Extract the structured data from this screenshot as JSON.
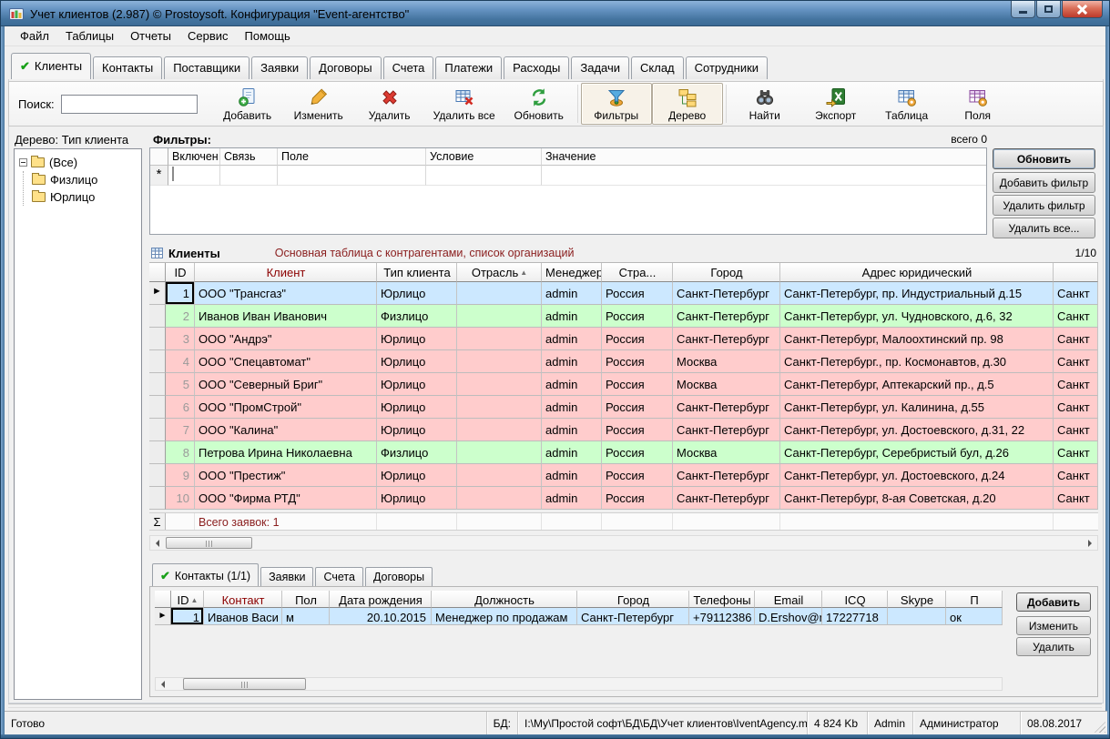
{
  "window": {
    "title": "Учет клиентов (2.987) © Prostoysoft. Конфигурация \"Event-агентство\""
  },
  "menu": {
    "items": [
      "Файл",
      "Таблицы",
      "Отчеты",
      "Сервис",
      "Помощь"
    ]
  },
  "tabs": {
    "items": [
      {
        "label": "Клиенты",
        "active": true
      },
      {
        "label": "Контакты",
        "active": false
      },
      {
        "label": "Поставщики",
        "active": false
      },
      {
        "label": "Заявки",
        "active": false
      },
      {
        "label": "Договоры",
        "active": false
      },
      {
        "label": "Счета",
        "active": false
      },
      {
        "label": "Платежи",
        "active": false
      },
      {
        "label": "Расходы",
        "active": false
      },
      {
        "label": "Задачи",
        "active": false
      },
      {
        "label": "Склад",
        "active": false
      },
      {
        "label": "Сотрудники",
        "active": false
      }
    ]
  },
  "toolbar": {
    "search_label": "Поиск:",
    "search_value": "",
    "buttons": [
      {
        "name": "add",
        "label": "Добавить",
        "toggled": false
      },
      {
        "name": "edit",
        "label": "Изменить",
        "toggled": false
      },
      {
        "name": "delete",
        "label": "Удалить",
        "toggled": false
      },
      {
        "name": "delete-all",
        "label": "Удалить все",
        "toggled": false
      },
      {
        "name": "refresh",
        "label": "Обновить",
        "toggled": false
      },
      {
        "name": "filters",
        "label": "Фильтры",
        "toggled": true
      },
      {
        "name": "tree",
        "label": "Дерево",
        "toggled": true
      },
      {
        "name": "find",
        "label": "Найти",
        "toggled": false
      },
      {
        "name": "export",
        "label": "Экспорт",
        "toggled": false
      },
      {
        "name": "table",
        "label": "Таблица",
        "toggled": false
      },
      {
        "name": "fields",
        "label": "Поля",
        "toggled": false
      }
    ]
  },
  "tree": {
    "title": "Дерево: Тип клиента",
    "root": "(Все)",
    "children": [
      "Физлицо",
      "Юрлицо"
    ]
  },
  "filters": {
    "title": "Фильтры:",
    "count_label": "всего 0",
    "columns": [
      "Включен",
      "Связь",
      "Поле",
      "Условие",
      "Значение"
    ],
    "buttons": [
      {
        "label": "Обновить",
        "default": true
      },
      {
        "label": "Добавить фильтр",
        "default": false
      },
      {
        "label": "Удалить фильтр",
        "default": false
      },
      {
        "label": "Удалить все...",
        "default": false
      }
    ]
  },
  "clients": {
    "title": "Клиенты",
    "subtitle": "Основная таблица с контрагентами, список организаций",
    "pager": "1/10",
    "columns": [
      {
        "label": "ID",
        "accent": false,
        "sorted": false
      },
      {
        "label": "Клиент",
        "accent": true,
        "sorted": false
      },
      {
        "label": "Тип клиента",
        "accent": false,
        "sorted": false
      },
      {
        "label": "Отрасль",
        "accent": false,
        "sorted": true
      },
      {
        "label": "Менеджер",
        "accent": false,
        "sorted": false
      },
      {
        "label": "Стра...",
        "accent": false,
        "sorted": false
      },
      {
        "label": "Город",
        "accent": false,
        "sorted": false
      },
      {
        "label": "Адрес юридический",
        "accent": false,
        "sorted": false
      },
      {
        "label": "",
        "accent": false,
        "sorted": false
      }
    ],
    "rows": [
      {
        "id": "1",
        "client": "ООО \"Трансгаз\"",
        "type": "Юрлицо",
        "industry": "",
        "manager": "admin",
        "country": "Россия",
        "city": "Санкт-Петербург",
        "address": "Санкт-Петербург, пр. Индустриальный д.15",
        "address2": "Санкт",
        "state": "selected"
      },
      {
        "id": "2",
        "client": "Иванов Иван Иванович",
        "type": "Физлицо",
        "industry": "",
        "manager": "admin",
        "country": "Россия",
        "city": "Санкт-Петербург",
        "address": "Санкт-Петербург, ул. Чудновского, д.6, 32",
        "address2": "Санкт",
        "state": "person"
      },
      {
        "id": "3",
        "client": "ООО \"Андрэ\"",
        "type": "Юрлицо",
        "industry": "",
        "manager": "admin",
        "country": "Россия",
        "city": "Санкт-Петербург",
        "address": "Санкт-Петербург, Малоохтинский пр. 98",
        "address2": "Санкт",
        "state": "org"
      },
      {
        "id": "4",
        "client": "ООО \"Спецавтомат\"",
        "type": "Юрлицо",
        "industry": "",
        "manager": "admin",
        "country": "Россия",
        "city": "Москва",
        "address": "Санкт-Петербург., пр. Космонавтов, д.30",
        "address2": "Санкт",
        "state": "org"
      },
      {
        "id": "5",
        "client": "ООО \"Северный Бриг\"",
        "type": "Юрлицо",
        "industry": "",
        "manager": "admin",
        "country": "Россия",
        "city": "Москва",
        "address": "Санкт-Петербург, Аптекарский пр., д.5",
        "address2": "Санкт",
        "state": "org"
      },
      {
        "id": "6",
        "client": "ООО \"ПромСтрой\"",
        "type": "Юрлицо",
        "industry": "",
        "manager": "admin",
        "country": "Россия",
        "city": "Санкт-Петербург",
        "address": "Санкт-Петербург, ул. Калинина, д.55",
        "address2": "Санкт",
        "state": "org"
      },
      {
        "id": "7",
        "client": "ООО \"Калина\"",
        "type": "Юрлицо",
        "industry": "",
        "manager": "admin",
        "country": "Россия",
        "city": "Санкт-Петербург",
        "address": "Санкт-Петербург, ул. Достоевского, д.31, 22",
        "address2": "Санкт",
        "state": "org"
      },
      {
        "id": "8",
        "client": "Петрова Ирина Николаевна",
        "type": "Физлицо",
        "industry": "",
        "manager": "admin",
        "country": "Россия",
        "city": "Москва",
        "address": "Санкт-Петербург, Серебристый бул, д.26",
        "address2": "Санкт",
        "state": "person"
      },
      {
        "id": "9",
        "client": "ООО \"Престиж\"",
        "type": "Юрлицо",
        "industry": "",
        "manager": "admin",
        "country": "Россия",
        "city": "Санкт-Петербург",
        "address": "Санкт-Петербург, ул. Достоевского, д.24",
        "address2": "Санкт",
        "state": "org"
      },
      {
        "id": "10",
        "client": "ООО \"Фирма РТД\"",
        "type": "Юрлицо",
        "industry": "",
        "manager": "admin",
        "country": "Россия",
        "city": "Санкт-Петербург",
        "address": "Санкт-Петербург, 8-ая Советская, д.20",
        "address2": "Санкт",
        "state": "org"
      }
    ],
    "footer_text": "Всего заявок: 1"
  },
  "details": {
    "tabs": [
      {
        "label": "Контакты (1/1)",
        "active": true
      },
      {
        "label": "Заявки",
        "active": false
      },
      {
        "label": "Счета",
        "active": false
      },
      {
        "label": "Договоры",
        "active": false
      }
    ],
    "columns": [
      {
        "label": "ID",
        "accent": false,
        "sorted": true
      },
      {
        "label": "Контакт",
        "accent": true,
        "sorted": false
      },
      {
        "label": "Пол",
        "accent": false,
        "sorted": false
      },
      {
        "label": "Дата рождения",
        "accent": false,
        "sorted": false
      },
      {
        "label": "Должность",
        "accent": false,
        "sorted": false
      },
      {
        "label": "Город",
        "accent": false,
        "sorted": false
      },
      {
        "label": "Телефоны",
        "accent": false,
        "sorted": false
      },
      {
        "label": "Email",
        "accent": false,
        "sorted": false
      },
      {
        "label": "ICQ",
        "accent": false,
        "sorted": false
      },
      {
        "label": "Skype",
        "accent": false,
        "sorted": false
      },
      {
        "label": "П",
        "accent": false,
        "sorted": false
      }
    ],
    "row": {
      "id": "1",
      "contact": "Иванов Васи",
      "gender": "м",
      "birth": "20.10.2015",
      "position": "Менеджер по продажам",
      "city": "Санкт-Петербург",
      "phones": "+79112386",
      "email": "D.Ershov@mai",
      "icq": "17227718",
      "skype": "",
      "note": "ок"
    },
    "buttons": [
      {
        "label": "Добавить",
        "default": true
      },
      {
        "label": "Изменить",
        "default": false
      },
      {
        "label": "Удалить",
        "default": false
      }
    ]
  },
  "statusbar": {
    "ready": "Готово",
    "db_label": "БД:",
    "db_path": "I:\\My\\Простой софт\\БД\\БД\\Учет клиентов\\IventAgency.mdb",
    "size": "4 824 Kb",
    "user": "Admin",
    "role": "Администратор",
    "date": "08.08.2017"
  },
  "ui_glyphs": {
    "check": "✔",
    "sort_asc": "▲",
    "row_selector": "►",
    "new_row": "*",
    "sigma": "Σ"
  },
  "colors": {
    "selected_row": "#CCE8FF",
    "person_row": "#CCFFCC",
    "org_row": "#FFCCCC",
    "accent_header": "#8B0000",
    "subtitle_text": "#8B2020",
    "check_green": "#18A018"
  }
}
